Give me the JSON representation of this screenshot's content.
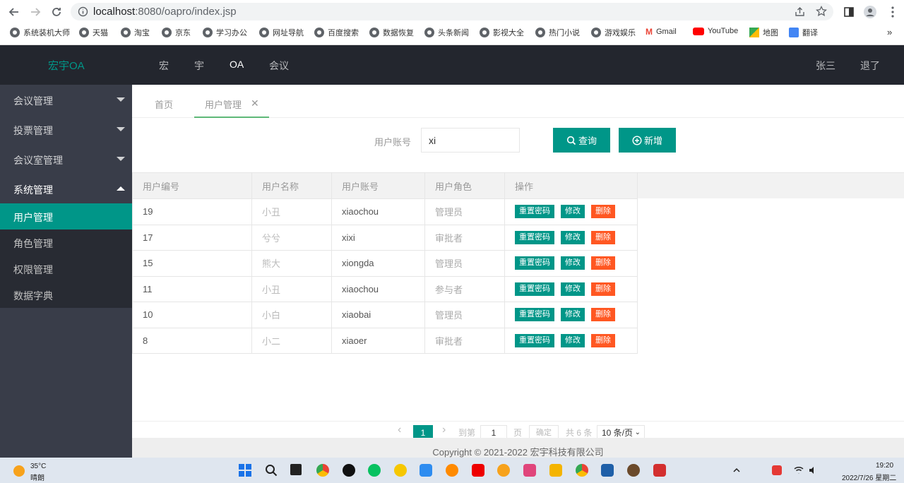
{
  "browser": {
    "url_host": "localhost",
    "url_path": ":8080/oapro/index.jsp",
    "bookmarks": [
      "系统装机大师",
      "天猫",
      "淘宝",
      "京东",
      "学习办公",
      "网址导航",
      "百度搜索",
      "数据恢复",
      "头条新闻",
      "影视大全",
      "热门小说",
      "游戏娱乐",
      "Gmail",
      "YouTube",
      "地图",
      "翻译"
    ],
    "more": "»"
  },
  "header": {
    "logo": "宏宇OA",
    "nav": [
      "宏",
      "宇",
      "OA",
      "会议"
    ],
    "user": "张三",
    "logout": "退了"
  },
  "sidebar": {
    "groups": [
      "会议管理",
      "投票管理",
      "会议室管理",
      "系统管理"
    ],
    "sub_items": [
      "用户管理",
      "角色管理",
      "权限管理",
      "数据字典"
    ]
  },
  "tabs": {
    "home": "首页",
    "user": "用户管理",
    "close": "✕"
  },
  "search": {
    "label": "用户账号",
    "value": "xi",
    "query_button": "查询",
    "add_button": "新增"
  },
  "table": {
    "headers": [
      "用户编号",
      "用户名称",
      "用户账号",
      "用户角色",
      "操作"
    ],
    "rows": [
      {
        "id": "19",
        "name": "小丑",
        "account": "xiaochou",
        "role": "管理员"
      },
      {
        "id": "17",
        "name": "兮兮",
        "account": "xixi",
        "role": "审批者"
      },
      {
        "id": "15",
        "name": "熊大",
        "account": "xiongda",
        "role": "管理员"
      },
      {
        "id": "11",
        "name": "小丑",
        "account": "xiaochou",
        "role": "参与者"
      },
      {
        "id": "10",
        "name": "小白",
        "account": "xiaobai",
        "role": "管理员"
      },
      {
        "id": "8",
        "name": "小二",
        "account": "xiaoer",
        "role": "审批者"
      }
    ],
    "actions": {
      "reset": "重置密码",
      "edit": "修改",
      "delete": "删除"
    }
  },
  "pager": {
    "prev": "‹",
    "current": "1",
    "next": "›",
    "goto_label": "到第",
    "goto_value": "1",
    "page_unit": "页",
    "confirm": "确定",
    "total": "共 6 条",
    "page_size": "10 条/页"
  },
  "footer": "Copyright © 2021-2022 宏宇科技有限公司",
  "taskbar": {
    "temp": "35°C",
    "weather": "晴朗",
    "time": "19:20",
    "date": "2022/7/26 星期二"
  },
  "colors": {
    "accent": "#009688",
    "danger": "#ff5722",
    "header": "#23262e",
    "sidebar": "#393d49"
  }
}
